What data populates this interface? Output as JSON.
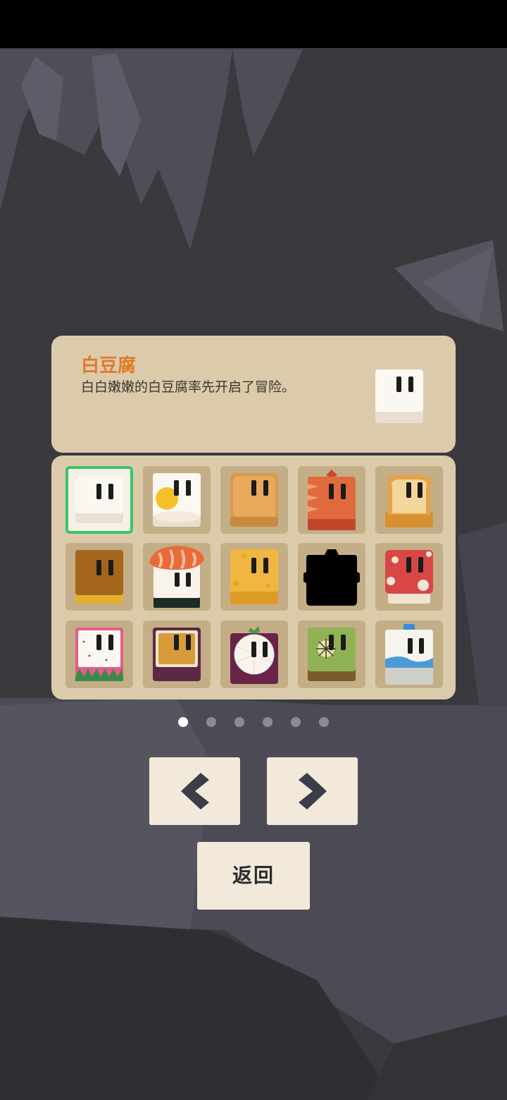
{
  "screen": "character-select",
  "selected_character": {
    "name": "白豆腐",
    "description": "白白嫩嫩的白豆腐率先开启了冒险。",
    "icon": "white-tofu-character-icon"
  },
  "character_grid": {
    "rows": [
      [
        {
          "icon": "white-tofu-icon",
          "locked": false,
          "selected": true
        },
        {
          "icon": "fried-egg-tofu-icon",
          "locked": false,
          "selected": false
        },
        {
          "icon": "fried-tofu-icon",
          "locked": false,
          "selected": false
        },
        {
          "icon": "strawberry-cake-icon",
          "locked": false,
          "selected": false
        },
        {
          "icon": "toast-bread-icon",
          "locked": false,
          "selected": false
        }
      ],
      [
        {
          "icon": "brown-pudding-icon",
          "locked": false,
          "selected": false
        },
        {
          "icon": "salmon-sushi-icon",
          "locked": false,
          "selected": false
        },
        {
          "icon": "cheese-block-icon",
          "locked": false,
          "selected": false
        },
        {
          "icon": "locked-silhouette-icon",
          "locked": true,
          "selected": false
        },
        {
          "icon": "mushroom-cap-icon",
          "locked": false,
          "selected": false
        }
      ],
      [
        {
          "icon": "dragon-fruit-icon",
          "locked": false,
          "selected": false
        },
        {
          "icon": "passion-fruit-icon",
          "locked": false,
          "selected": false
        },
        {
          "icon": "mangosteen-icon",
          "locked": false,
          "selected": false
        },
        {
          "icon": "kiwi-icon",
          "locked": false,
          "selected": false
        },
        {
          "icon": "milk-carton-icon",
          "locked": false,
          "selected": false
        }
      ]
    ]
  },
  "pagination": {
    "current_page": 1,
    "total_pages": 6
  },
  "buttons": {
    "prev_icon": "chevron-left-icon",
    "next_icon": "chevron-right-icon",
    "back_label": "返回"
  },
  "colors": {
    "background": "#3b393e",
    "panel": "#dccbab",
    "cell": "#c4ae87",
    "title_orange": "#e17a2a",
    "selection_green": "#3bc46a",
    "button": "#f2e9da"
  }
}
